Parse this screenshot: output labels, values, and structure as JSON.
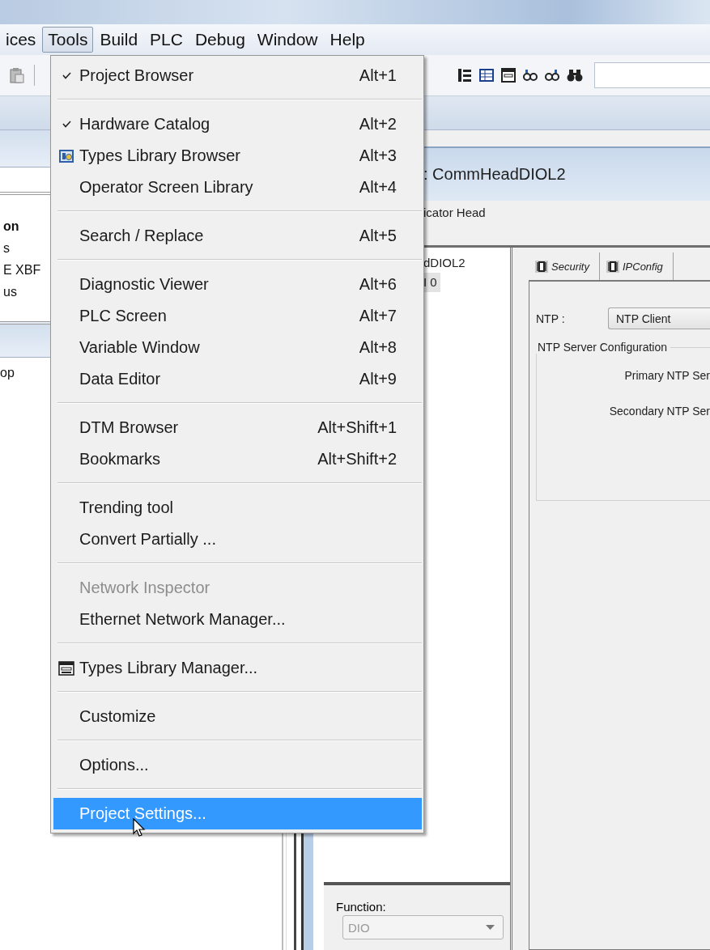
{
  "menubar": {
    "items": [
      {
        "label": "ices",
        "selected": false
      },
      {
        "label": "Tools",
        "selected": true
      },
      {
        "label": "Build",
        "selected": false
      },
      {
        "label": "PLC",
        "selected": false
      },
      {
        "label": "Debug",
        "selected": false
      },
      {
        "label": "Window",
        "selected": false
      },
      {
        "label": "Help",
        "selected": false
      }
    ]
  },
  "left_panel": {
    "items": [
      {
        "label": "on",
        "kind": "heading"
      },
      {
        "label": "s",
        "kind": "item"
      },
      {
        "label": "E XBF",
        "kind": "item"
      },
      {
        "label": "us",
        "kind": "item"
      },
      {
        "label": "op",
        "kind": "item"
      }
    ]
  },
  "document": {
    "title": ": CommHeadDIOL2",
    "subtitle": "icator Head",
    "tree": [
      {
        "label": "dDIOL2",
        "selected": false
      },
      {
        "label": "I 0",
        "selected": true
      }
    ],
    "tabs": [
      {
        "label": "Security",
        "selected": false
      },
      {
        "label": "IPConfig",
        "selected": false
      }
    ],
    "ntp": {
      "label": "NTP :",
      "value": "NTP Client"
    },
    "group": {
      "title": "NTP Server Configuration",
      "fields": [
        "Primary NTP Ser",
        "Secondary NTP Ser"
      ]
    },
    "function": {
      "label": "Function:",
      "value": "DIO",
      "disabled": true
    }
  },
  "menu": {
    "groups": [
      {
        "items": [
          {
            "label": "Project Browser",
            "shortcut": "Alt+1",
            "kind": "checkable",
            "checked": true,
            "disabled": false,
            "selected": false
          }
        ]
      },
      {
        "items": [
          {
            "label": "Hardware Catalog",
            "shortcut": "Alt+2",
            "kind": "checkable",
            "checked": true,
            "disabled": false,
            "selected": false
          },
          {
            "label": "Types Library Browser",
            "shortcut": "Alt+3",
            "kind": "browser",
            "disabled": false,
            "selected": false
          },
          {
            "label": "Operator Screen Library",
            "shortcut": "Alt+4",
            "kind": "plain",
            "disabled": false,
            "selected": false
          }
        ]
      },
      {
        "items": [
          {
            "label": "Search / Replace",
            "shortcut": "Alt+5",
            "kind": "plain",
            "disabled": false,
            "selected": false
          }
        ]
      },
      {
        "items": [
          {
            "label": "Diagnostic Viewer",
            "shortcut": "Alt+6",
            "kind": "plain",
            "disabled": false,
            "selected": false
          },
          {
            "label": "PLC Screen",
            "shortcut": "Alt+7",
            "kind": "plain",
            "disabled": false,
            "selected": false
          },
          {
            "label": "Variable Window",
            "shortcut": "Alt+8",
            "kind": "plain",
            "disabled": false,
            "selected": false
          },
          {
            "label": "Data Editor",
            "shortcut": "Alt+9",
            "kind": "plain",
            "disabled": false,
            "selected": false
          }
        ]
      },
      {
        "items": [
          {
            "label": "DTM Browser",
            "shortcut": "Alt+Shift+1",
            "kind": "plain",
            "disabled": false,
            "selected": false
          },
          {
            "label": "Bookmarks",
            "shortcut": "Alt+Shift+2",
            "kind": "plain",
            "disabled": false,
            "selected": false
          }
        ]
      },
      {
        "items": [
          {
            "label": "Trending tool",
            "kind": "plain",
            "disabled": false,
            "selected": false
          },
          {
            "label": "Convert Partially ...",
            "kind": "plain",
            "disabled": false,
            "selected": false
          }
        ]
      },
      {
        "items": [
          {
            "label": "Network Inspector",
            "kind": "plain",
            "disabled": true,
            "selected": false
          },
          {
            "label": "Ethernet Network Manager...",
            "kind": "plain",
            "disabled": false,
            "selected": false
          }
        ]
      },
      {
        "items": [
          {
            "label": "Types Library Manager...",
            "kind": "manager",
            "disabled": false,
            "selected": false
          }
        ]
      },
      {
        "items": [
          {
            "label": "Customize",
            "kind": "plain",
            "disabled": false,
            "selected": false
          }
        ]
      },
      {
        "items": [
          {
            "label": "Options...",
            "kind": "plain",
            "disabled": false,
            "selected": false
          }
        ]
      },
      {
        "items": [
          {
            "label": "Project Settings...",
            "kind": "plain",
            "disabled": false,
            "selected": true
          }
        ]
      }
    ]
  }
}
